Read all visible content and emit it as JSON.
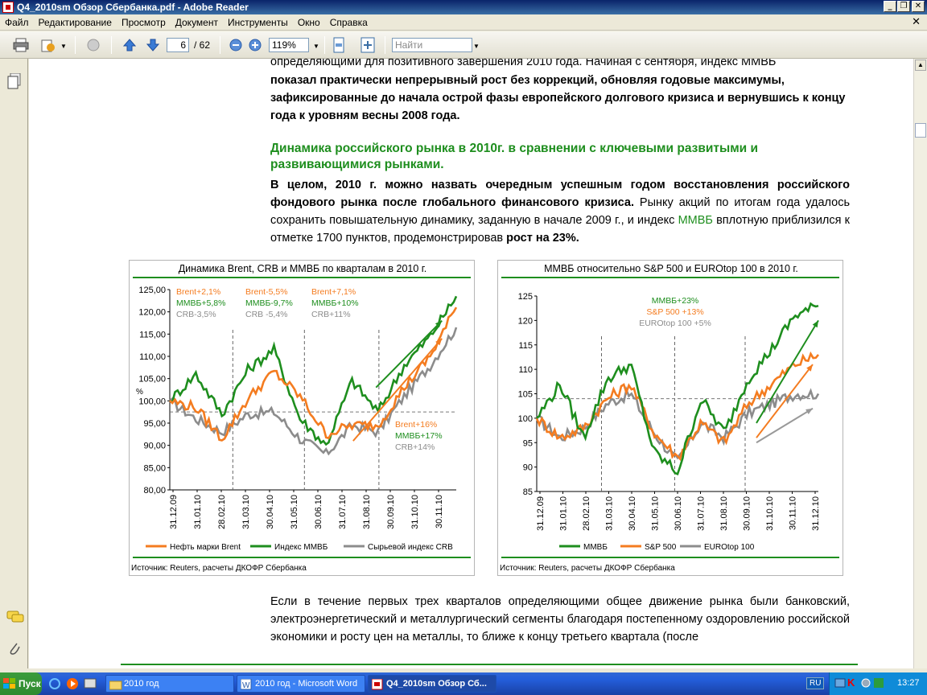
{
  "window": {
    "title": "Q4_2010sm Обзор Сбербанка.pdf - Adobe Reader"
  },
  "menu": [
    "Файл",
    "Редактирование",
    "Просмотр",
    "Документ",
    "Инструменты",
    "Окно",
    "Справка"
  ],
  "toolbar": {
    "page_current": "6",
    "page_total": "/ 62",
    "zoom": "119%",
    "search_placeholder": "Найти"
  },
  "doc": {
    "p1_line1": "определяющими для позитивного завершения 2010 года. Начиная с сентября, индекс ММВБ",
    "p1_line2": "показал практически непрерывный рост без коррекций, обновляя годовые максимумы,",
    "p1_line3": "зафиксированные до начала острой фазы европейского долгового кризиса и вернувшись к концу",
    "p1_line4": "года к уровням весны 2008 года.",
    "heading": "Динамика российского рынка в 2010г. в сравнении с ключевыми развитыми и развивающимися рынками.",
    "p2_bold": "В целом, 2010 г. можно назвать очередным успешным годом восстановления российского фондового рынка после глобального финансового кризиса.",
    "p2_rest_a": " Рынку акций по итогам года удалось сохранить повышательную динамику, заданную в начале 2009 г., и индекс ",
    "p2_mmvb": "ММВБ",
    "p2_rest_b": " вплотную приблизился к отметке 1700 пунктов, продемонстрировав ",
    "p2_growth": "рост на 23%.",
    "p3": "Если в течение первых трех кварталов определяющими общее движение рынка были банковский, электроэнергетический и металлургический сегменты благодаря постепенному оздоровлению российской экономики и росту цен на металлы, то ближе к концу третьего квартала (после"
  },
  "chart_data": [
    {
      "type": "line",
      "title": "Динамика Brent, CRB и ММВБ по кварталам в 2010 г.",
      "ylabel": "%",
      "ylim": [
        80,
        125
      ],
      "yticks": [
        "80,00",
        "85,00",
        "90,00",
        "95,00",
        "100,00",
        "105,00",
        "110,00",
        "115,00",
        "120,00",
        "125,00"
      ],
      "xticks": [
        "31.12.09",
        "31.01.10",
        "28.02.10",
        "31.03.10",
        "30.04.10",
        "31.05.10",
        "30.06.10",
        "31.07.10",
        "31.08.10",
        "30.09.10",
        "31.10.10",
        "30.11.10"
      ],
      "series": [
        {
          "name": "Нефть марки Brent",
          "color": "#f47c20",
          "values": [
            100,
            98.5,
            91.5,
            100.5,
            106.5,
            101,
            92.5,
            94.5,
            94.5,
            103,
            110,
            121
          ]
        },
        {
          "name": "Индекс ММВБ",
          "color": "#1e8e1e",
          "values": [
            100,
            106,
            97,
            107,
            111.5,
            96,
            90,
            104.5,
            97.5,
            108,
            114.5,
            123.5
          ]
        },
        {
          "name": "Сырьевой индекс CRB",
          "color": "#8c8c8c",
          "values": [
            100,
            96,
            93,
            97,
            97.5,
            91.5,
            88,
            94.5,
            93,
            101,
            108,
            116.5
          ]
        }
      ],
      "annotations": [
        {
          "group": "Q1",
          "lines": [
            {
              "text": "Brent+2,1%",
              "color": "#f47c20"
            },
            {
              "text": "ММВБ+5,8%",
              "color": "#1e8e1e"
            },
            {
              "text": "CRB-3,5%",
              "color": "#8c8c8c"
            }
          ]
        },
        {
          "group": "Q2",
          "lines": [
            {
              "text": "Brent-5,5%",
              "color": "#f47c20"
            },
            {
              "text": "ММВБ-9,7%",
              "color": "#1e8e1e"
            },
            {
              "text": "CRB -5,4%",
              "color": "#8c8c8c"
            }
          ]
        },
        {
          "group": "Q3",
          "lines": [
            {
              "text": "Brent+7,1%",
              "color": "#f47c20"
            },
            {
              "text": "ММВБ+10%",
              "color": "#1e8e1e"
            },
            {
              "text": "CRB+11%",
              "color": "#8c8c8c"
            }
          ]
        },
        {
          "group": "Q4",
          "lines": [
            {
              "text": "Brent+16%",
              "color": "#f47c20"
            },
            {
              "text": "ММВБ+17%",
              "color": "#1e8e1e"
            },
            {
              "text": "CRB+14%",
              "color": "#8c8c8c"
            }
          ]
        }
      ],
      "source": "Источник: Reuters, расчеты ДКОФР Сбербанка",
      "legend": "bottom"
    },
    {
      "type": "line",
      "title": "ММВБ относительно S&P 500 и  EUROtop 100 в 2010 г.",
      "ylim": [
        85,
        125
      ],
      "yticks": [
        "85",
        "90",
        "95",
        "100",
        "105",
        "110",
        "115",
        "120",
        "125"
      ],
      "xticks": [
        "31.12.09",
        "31.01.10",
        "28.02.10",
        "31.03.10",
        "30.04.10",
        "31.05.10",
        "30.06.10",
        "31.07.10",
        "31.08.10",
        "30.09.10",
        "31.10.10",
        "30.11.10",
        "31.12.10"
      ],
      "series": [
        {
          "name": "ММВБ",
          "color": "#1e8e1e",
          "values": [
            100,
            107,
            96,
            108,
            111,
            93,
            89,
            104,
            97,
            108,
            114,
            121,
            123
          ]
        },
        {
          "name": "S&P 500",
          "color": "#f47c20",
          "values": [
            100,
            96,
            98,
            104,
            107,
            97,
            92,
            99,
            95,
            103,
            107,
            111,
            113
          ]
        },
        {
          "name": "EUROtop 100",
          "color": "#8c8c8c",
          "values": [
            100,
            96,
            98,
            103,
            105,
            97,
            91,
            99,
            96,
            101,
            103,
            105,
            105
          ]
        }
      ],
      "annotations": [
        {
          "text": "ММВБ+23%",
          "color": "#1e8e1e"
        },
        {
          "text": "S&P 500 +13%",
          "color": "#f47c20"
        },
        {
          "text": "EUROtop 100 +5%",
          "color": "#8c8c8c"
        }
      ],
      "source": "Источник: Reuters, расчеты ДКОФР Сбербанка",
      "legend": "bottom"
    }
  ],
  "taskbar": {
    "start": "Пуск",
    "tasks": [
      "2010 год",
      "2010 год - Microsoft Word",
      "Q4_2010sm Обзор Сб..."
    ],
    "lang": "RU",
    "clock": "13:27"
  }
}
